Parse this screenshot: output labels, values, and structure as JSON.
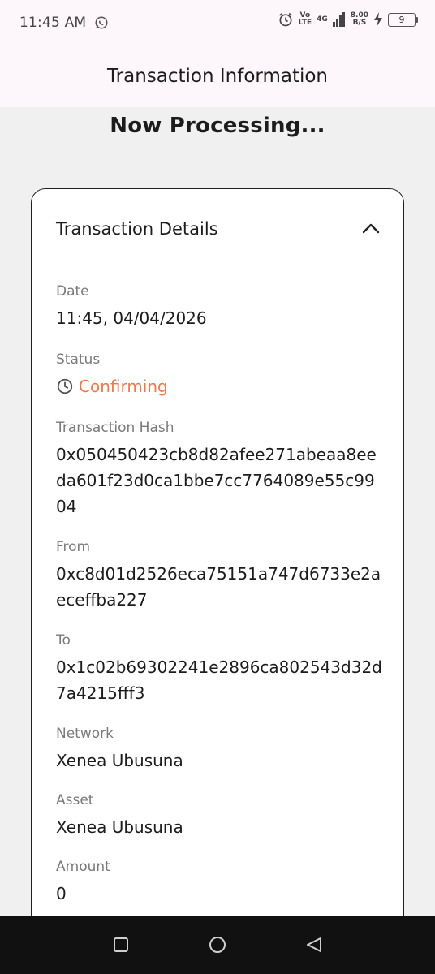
{
  "status_bar": {
    "time": "11:45 AM",
    "volte_top": "Vo",
    "volte_bottom": "LTE",
    "network_type": "4G",
    "speed_value": "8.00",
    "speed_unit": "B/S",
    "battery_level": "9"
  },
  "app_bar": {
    "title": "Transaction Information"
  },
  "processing_text": "Now Processing...",
  "card": {
    "title": "Transaction Details",
    "fields": {
      "date": {
        "label": "Date",
        "value": "11:45, 04/04/2026"
      },
      "status": {
        "label": "Status",
        "value": "Confirming",
        "color": "#ec7a4a"
      },
      "hash": {
        "label": "Transaction Hash",
        "value": "0x050450423cb8d82afee271abeaa8eeda601f23d0ca1bbe7cc7764089e55c9904"
      },
      "from": {
        "label": "From",
        "value": "0xc8d01d2526eca75151a747d6733e2aeceffba227"
      },
      "to": {
        "label": "To",
        "value": "0x1c02b69302241e2896ca802543d32d7a4215fff3"
      },
      "network": {
        "label": "Network",
        "value": "Xenea Ubusuna"
      },
      "asset": {
        "label": "Asset",
        "value": "Xenea Ubusuna"
      },
      "amount": {
        "label": "Amount",
        "value": "0"
      }
    }
  },
  "icons": {
    "whatsapp": "whatsapp-icon",
    "alarm": "alarm-icon",
    "signal": "signal-icon",
    "charging": "charging-icon",
    "chevron_up": "chevron-up-icon",
    "clock": "clock-icon",
    "recents": "square-icon",
    "home": "circle-icon",
    "back": "triangle-back-icon"
  }
}
